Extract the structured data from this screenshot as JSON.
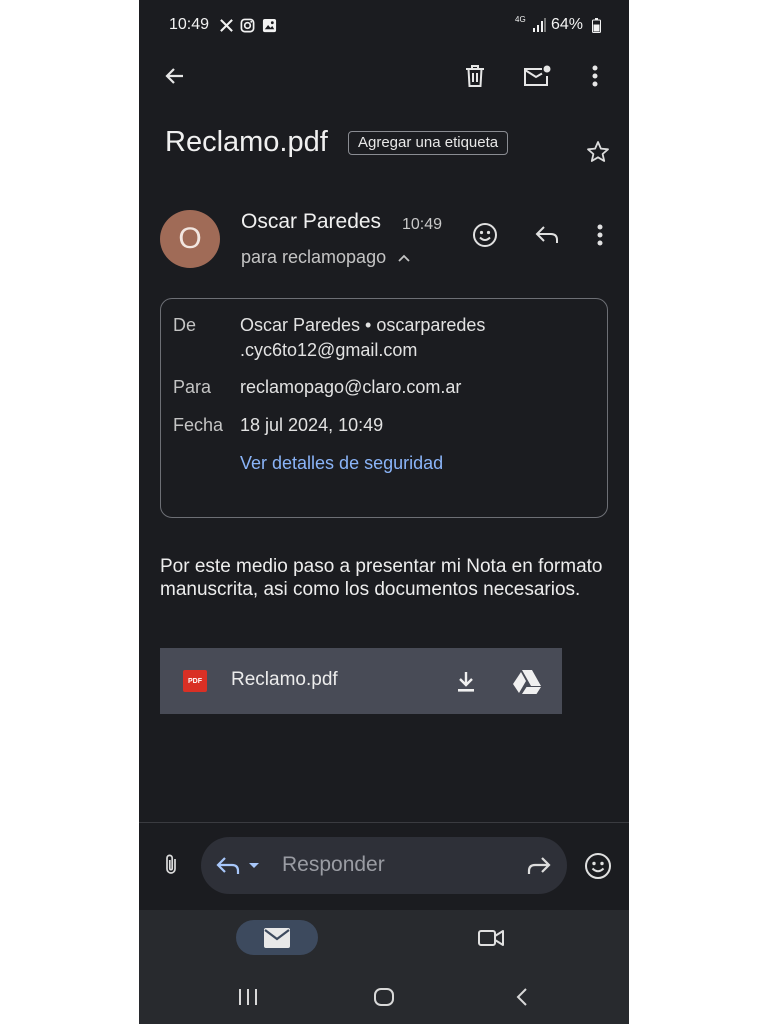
{
  "status_bar": {
    "time": "10:49",
    "network": "4G",
    "battery": "64%"
  },
  "toolbar": {
    "back_icon": "arrow-left-icon",
    "delete_icon": "trash-icon",
    "mark_unread_icon": "mail-unread-icon",
    "more_icon": "more-vert-icon"
  },
  "email": {
    "subject": "Reclamo.pdf",
    "label_chip": "Agregar una etiqueta",
    "sender_initial": "O",
    "sender_name": "Oscar Paredes",
    "time": "10:49",
    "to_line": "para reclamopago",
    "details": {
      "from_label": "De",
      "from_value_1": "Oscar Paredes • oscarparedes",
      "from_value_2": ".cyc6to12@gmail.com",
      "to_label": "Para",
      "to_value": "reclamopago@claro.com.ar",
      "date_label": "Fecha",
      "date_value": "18 jul 2024, 10:49",
      "security_link": "Ver detalles de seguridad"
    },
    "body": "Por este medio paso a presentar mi Nota en formato manuscrita, asi como los documentos necesarios.",
    "attachment": {
      "badge": "PDF",
      "name": "Reclamo.pdf"
    }
  },
  "reply_bar": {
    "placeholder": "Responder"
  },
  "colors": {
    "background": "#1b1c20",
    "link": "#8ab4f8",
    "avatar": "#a06b57",
    "attachment_bg": "#484b56",
    "pdf_red": "#d93025"
  }
}
